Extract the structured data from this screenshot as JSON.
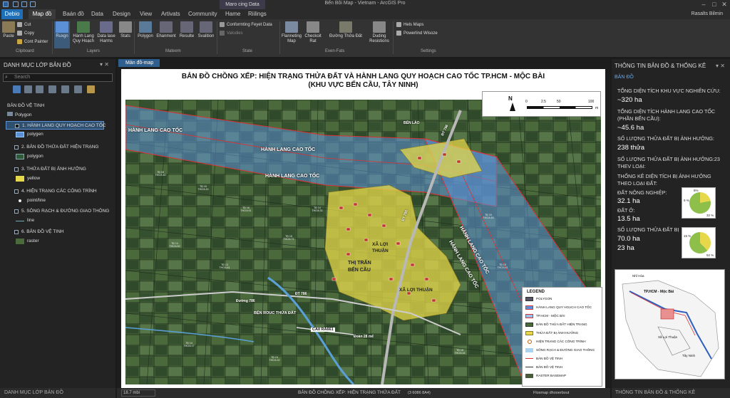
{
  "window": {
    "title": "Bến Bôi Map - Vietnam - ArcGIS Pro",
    "context_tab": "Maro cing Data",
    "user": "Rasalts Bilmin"
  },
  "tabs": [
    "Debio",
    "Map đồ",
    "Baán đồ",
    "Data",
    "Design",
    "View",
    "Artivats",
    "Community",
    "Hame",
    "Riilings"
  ],
  "ribbon": {
    "clipboard": {
      "paste": "Paste",
      "cut": "Cut",
      "copy": "Copy",
      "paint": "Cont Painter",
      "label": "Clipboard"
    },
    "layers": {
      "items": [
        "Ruxgn",
        "Hành Lang Quy Hoạch",
        "Data lase Harms",
        "Stats"
      ],
      "label": "Layers"
    },
    "mateem": {
      "items": [
        "Polygon",
        "Ehanment",
        "Resulte",
        "Svalition"
      ],
      "label": "Mateem"
    },
    "state": {
      "items": [
        "Conformting Feyet Data",
        "Valodies"
      ],
      "label": "State"
    },
    "exen": {
      "items": [
        "Flanneting Map",
        "Checkoit Rat",
        "Đường Thửa Đất",
        "Duding Resistions"
      ],
      "label": "Exen-Fats"
    },
    "settings": {
      "items": [
        "Hels Maps",
        "Powerlind Wisoze"
      ],
      "label": "Settings"
    }
  },
  "left_pane": {
    "title": "DANH MỤC LỚP BẢN ĐỒ",
    "search_placeholder": "Search",
    "root": "BẢN ĐỒ VỆ TINH",
    "group": "Polygon",
    "layers": [
      {
        "name": "1. HÀNH LANG QUY HOẠCH CAO TỐC",
        "sub": "polygen"
      },
      {
        "name": "2. BẢN ĐỒ THỬA ĐẤT HIỆN TRẠNG",
        "sub": "polygon"
      },
      {
        "name": "3. THỬA ĐẤT BỊ ẢNH HƯỞNG",
        "sub": "yellow"
      },
      {
        "name": "4. HIỆN TRẠNG CÁC CÔNG TRÌNH",
        "sub": "point/line"
      },
      {
        "name": "5. SÔNG RẠCH & ĐƯỜNG GIAO THÔNG",
        "sub": "line"
      },
      {
        "name": "6. BẢN ĐỒ VỆ TINH",
        "sub": "raster"
      }
    ],
    "footer": "DANH MỤC LỚP BẢN ĐỒ"
  },
  "map_tab": "Mản đồ-map",
  "map": {
    "title1": "BẢN ĐỒ CHỒNG XẾP: HIỆN TRẠNG THỬA ĐẤT VÀ HÀNH LANG QUY HOẠCH CAO TỐC TP.HCM - MỘC BÀI",
    "title2": "(KHU VỰC BẾN CẦU, TÂY NINH)",
    "labels": {
      "hl1": "HÀNH LANG CAO TỐC",
      "hl2": "HÀNH LANG CAO TỐC",
      "hl3": "HÀNH LANG CAO TỐC",
      "hl4": "HÀNH LANG CAO TỐC",
      "hl5": "HÀNH LANG CAO TỐC",
      "town1": "THỊ TRẤN",
      "town2": "BẾN CẦU",
      "xa1": "XÃ LỢI",
      "xa2": "THUẬN",
      "xa3": "XÃ LỢI THUẬN",
      "road1": "ĐT 786",
      "road2": "ĐT 786",
      "road3": "ĐT 786",
      "road4": "Đường 786",
      "road5": "Đoàn 28 mể",
      "road6": "BẾN LÀO",
      "caibay": "CAII RÀ661",
      "benrouc": "BỆN ROUC THỬA ĐẤT"
    },
    "scale": {
      "ticks": [
        "0",
        "2.5",
        "50",
        "100"
      ],
      "unit": "m"
    },
    "north": "N"
  },
  "legend": {
    "title": "LEGEND",
    "items": [
      "POLYGON",
      "HÀNH LANG QUY HOẠCH CAO TỐC",
      "TP.HCM - MỘC BÀI",
      "BẢN ĐỒ THỬA ĐẤT HIỆN TRẠNG",
      "THỬA ĐẤT BỊ ẢNH HƯỞNG",
      "HIỆN TRẠNG CÁC CÔNG TRÌNH",
      "SÔNG RẠCH & ĐƯỜNG GIAO THÔNG",
      "BẢN ĐỒ VỆ TINH",
      "BẢN ĐỒ VỆ TINH",
      "RASTER BASEMAP"
    ]
  },
  "status": {
    "scale": "18.7 mbi",
    "center": "BẢN ĐỒ CHỒNG XẾP: HIỆN TRẠNG THỬA ĐẤT",
    "coords": "(3 6086 8A4)",
    "right": "Floxmap dhooerbout"
  },
  "right_pane": {
    "title": "THÔNG TIN BẢN ĐỒ & THỐNG KÊ",
    "tab": "BẢN ĐỒ",
    "s1_label": "TỔNG DIỆN TÍCH KHU VỰC NGHIÊN CỨU:",
    "s1_value": "~320 ha",
    "s2_label1": "TỔNG DIỆN TÍCH HÀNH LANG CAO TỐC",
    "s2_label2": "(PHẦN BẾN CẦU):",
    "s2_value": "~45.6 ha",
    "s3_label": "SỐ LƯỢNG THỬA ĐẤT BỊ ẢNH HƯỞNG:",
    "s3_value": "238 thửa",
    "s4_label1": "SỐ LƯỢNG THỬA ĐẤT BỊ ẢNH HƯỞNG:23",
    "s4_label2": "THEV LOẠI:",
    "s5_label1": "THỐNG KÊ DIỆN TÍCH BỊ ẢNH HƯỞNG",
    "s5_label2": "THEO LOẠI ĐẤT:",
    "nn_label": "ĐẤT NÔNG NGHIỆP:",
    "nn_value": "32.1 ha",
    "do_label": "ĐẤT Ở:",
    "do_value": "13.5 ha",
    "sl_label": "SỐ LƯỢNG THỬA ĐẤT BỊ",
    "sl_value1": "70.0 ha",
    "sl_value2": "23 ha",
    "pie1": {
      "a": "6%",
      "b": "9 %",
      "c": "32 %"
    },
    "pie2": {
      "a": "15 %",
      "b": "52 %"
    },
    "inset": {
      "a": "Nhĩ Hòa",
      "b": "TP.HCM - Mộc Bài",
      "c": "Xã Lợi Thuận",
      "d": "Tây Ninh"
    },
    "footer": "THÔNG TIN BẢN ĐỒ & THỐNG KÊ"
  },
  "colors": {
    "corridor": "#5b8fd6",
    "affected": "#e6d84a",
    "boundary": "#e03030"
  }
}
